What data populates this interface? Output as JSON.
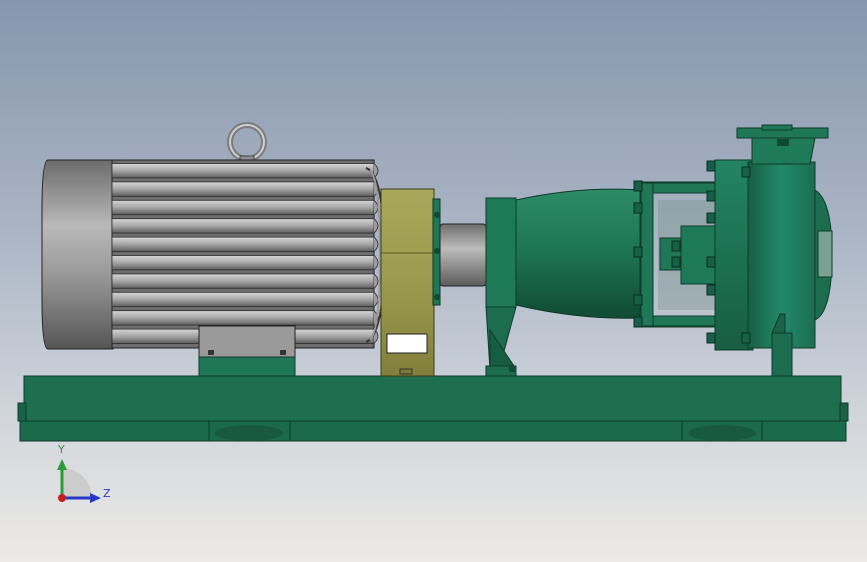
{
  "triad": {
    "y_label": "Y",
    "z_label": "Z",
    "y_color": "#2f9a3a",
    "z_color": "#2a38c8",
    "x_color": "#c81e1e"
  },
  "colors": {
    "machine_green": "#1f7757",
    "base_green": "#1d6d4f",
    "motor_gray": "#8a8a8a",
    "adapter_olive": "#9c9a4e",
    "background_top": "#8796ad",
    "background_bottom": "#eceae6"
  }
}
